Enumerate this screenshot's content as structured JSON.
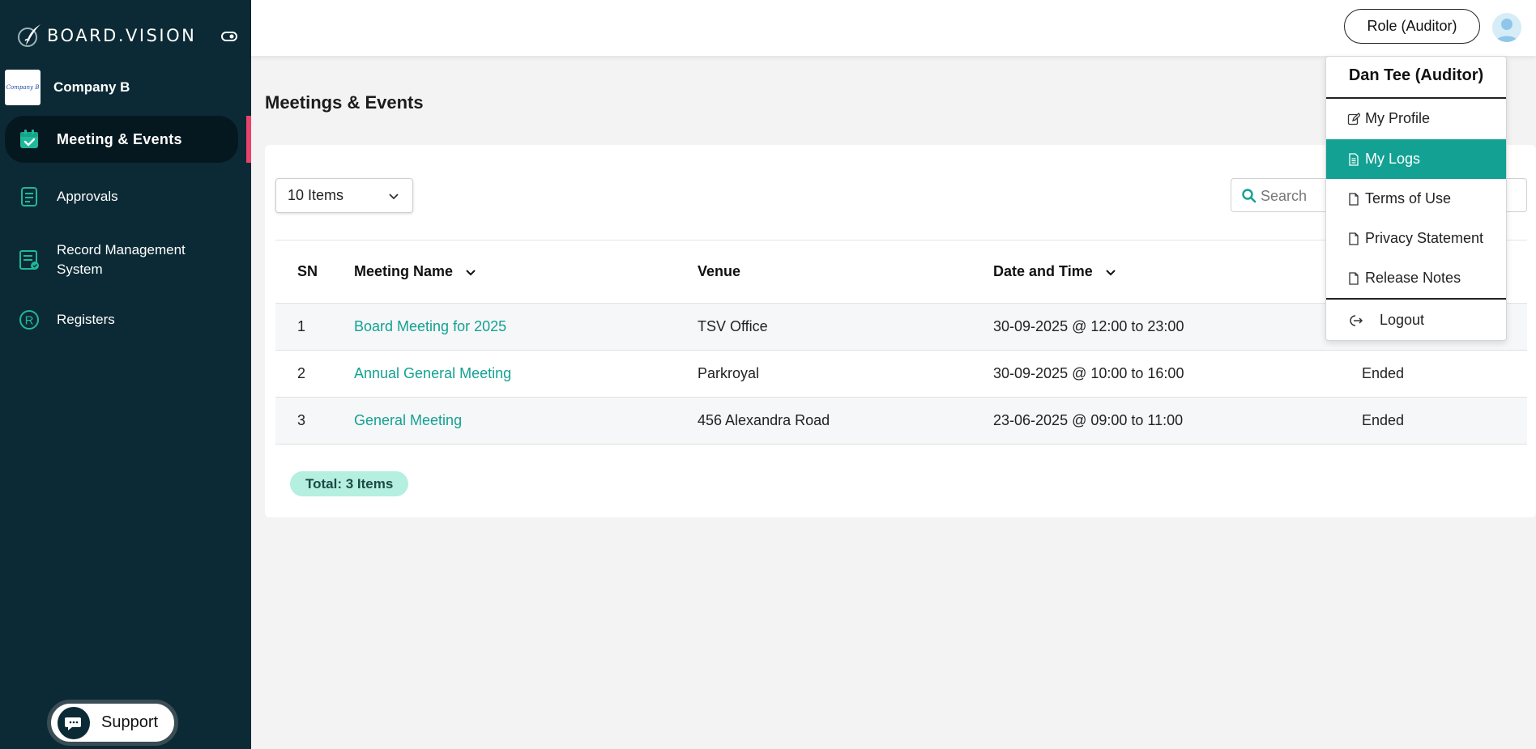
{
  "brand": {
    "name": "BOARD.VISION"
  },
  "company": {
    "name": "Company B",
    "logo_text": "Company B"
  },
  "sidebar": {
    "items": [
      {
        "label": "Meeting & Events",
        "icon": "calendar-check-icon",
        "active": true
      },
      {
        "label": "Approvals",
        "icon": "approvals-icon"
      },
      {
        "label": "Record Management System",
        "icon": "records-icon"
      },
      {
        "label": "Registers",
        "icon": "registers-icon"
      }
    ],
    "support_label": "Support"
  },
  "topbar": {
    "role_label": "Role (Auditor)"
  },
  "page": {
    "title": "Meetings & Events"
  },
  "controls": {
    "items_select": "10 Items",
    "search_placeholder": "Search"
  },
  "table": {
    "headers": {
      "sn": "SN",
      "name": "Meeting Name",
      "venue": "Venue",
      "date": "Date and Time"
    },
    "rows": [
      {
        "sn": "1",
        "name": "Board Meeting for 2025",
        "venue": "TSV Office",
        "date": "30-09-2025 @ 12:00 to 23:00",
        "status": ""
      },
      {
        "sn": "2",
        "name": "Annual General Meeting",
        "venue": "Parkroyal",
        "date": "30-09-2025 @ 10:00 to 16:00",
        "status": "Ended"
      },
      {
        "sn": "3",
        "name": "General Meeting",
        "venue": "456 Alexandra Road",
        "date": "23-06-2025 @ 09:00 to 11:00",
        "status": "Ended"
      }
    ],
    "total_label": "Total: 3 Items"
  },
  "user_menu": {
    "user": "Dan Tee (Auditor)",
    "items": [
      {
        "label": "My Profile",
        "icon": "edit-icon"
      },
      {
        "label": "My Logs",
        "icon": "document-icon",
        "active": true
      },
      {
        "label": "Terms of Use",
        "icon": "document-icon"
      },
      {
        "label": "Privacy Statement",
        "icon": "document-icon"
      },
      {
        "label": "Release Notes",
        "icon": "document-icon"
      }
    ],
    "logout_label": "Logout"
  },
  "colors": {
    "sidebar_bg": "#0c2a35",
    "accent": "#13a193",
    "active_marker": "#e8436b",
    "badge_bg": "#b4efe0"
  }
}
